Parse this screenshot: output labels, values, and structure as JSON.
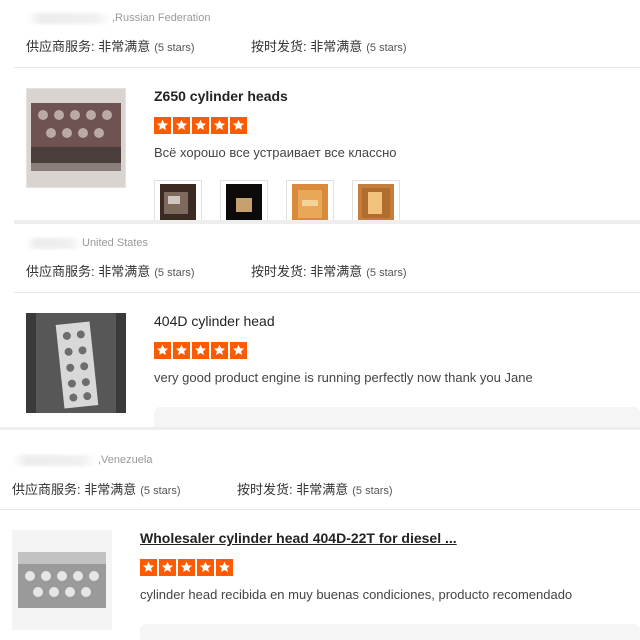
{
  "reviews": [
    {
      "country": ",Russian Federation",
      "service_label": "供应商服务: 非常满意",
      "service_stars_text": "(5 stars)",
      "shipping_label": "按时发货: 非常满意",
      "shipping_stars_text": "(5 stars)",
      "product_title": "Z650 cylinder heads",
      "rating": 5,
      "review_text": "Всё хорошо все устраивает все классно",
      "photos": [
        "photo-1",
        "photo-2",
        "photo-3",
        "photo-4"
      ]
    },
    {
      "country": "United States",
      "service_label": "供应商服务: 非常满意",
      "service_stars_text": "(5 stars)",
      "shipping_label": "按时发货: 非常满意",
      "shipping_stars_text": "(5 stars)",
      "product_title": "404D cylinder head",
      "rating": 5,
      "review_text": "very good product engine is running perfectly now thank you Jane"
    },
    {
      "country": ",Venezuela",
      "service_label": "供应商服务: 非常满意",
      "service_stars_text": "(5 stars)",
      "shipping_label": "按时发货: 非常满意",
      "shipping_stars_text": "(5 stars)",
      "product_title": "Wholesaler cylinder head 404D-22T for diesel ...",
      "rating": 5,
      "review_text": "cylinder head recibida en muy buenas condiciones, producto recomendado"
    }
  ],
  "colors": {
    "star": "#ff5a00",
    "divider": "#e6e6e6",
    "muted_text": "#999999"
  }
}
